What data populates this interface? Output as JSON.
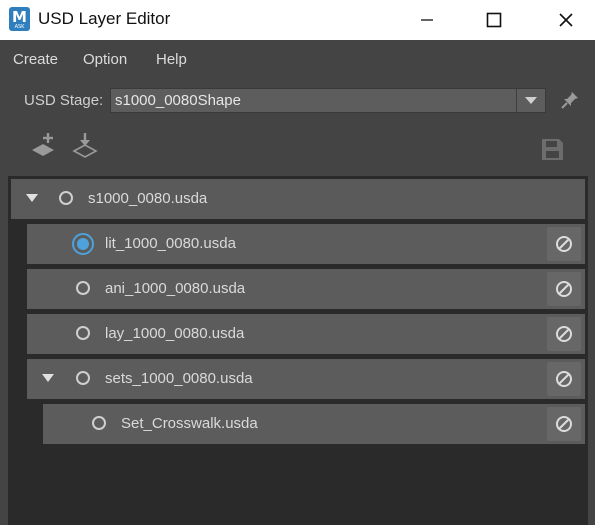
{
  "window": {
    "title": "USD Layer Editor",
    "app_icon_letter": "M",
    "app_icon_sub": "ASK"
  },
  "menu": {
    "items": [
      "Create",
      "Option",
      "Help"
    ]
  },
  "stage": {
    "label": "USD Stage:",
    "value": "s1000_0080Shape"
  },
  "layers": [
    {
      "name": "s1000_0080.usda",
      "depth": 0,
      "expanded": true,
      "editTarget": false,
      "muteButton": false
    },
    {
      "name": "lit_1000_0080.usda",
      "depth": 1,
      "expanded": false,
      "editTarget": true,
      "muteButton": true
    },
    {
      "name": "ani_1000_0080.usda",
      "depth": 1,
      "expanded": false,
      "editTarget": false,
      "muteButton": true
    },
    {
      "name": "lay_1000_0080.usda",
      "depth": 1,
      "expanded": false,
      "editTarget": false,
      "muteButton": true
    },
    {
      "name": "sets_1000_0080.usda",
      "depth": 1,
      "expanded": true,
      "editTarget": false,
      "muteButton": true
    },
    {
      "name": "Set_Crosswalk.usda",
      "depth": 2,
      "expanded": false,
      "editTarget": false,
      "muteButton": true
    }
  ],
  "colors": {
    "accent": "#4ea1db",
    "panel": "#444444",
    "row": "#5c5c5c",
    "tree_bg": "#2a2a2a"
  }
}
